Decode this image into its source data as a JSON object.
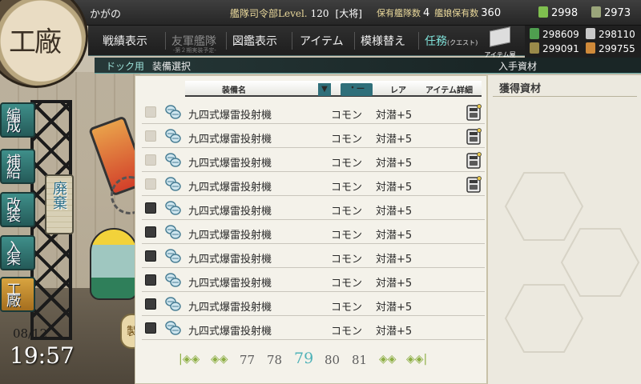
{
  "header": {
    "admiral_name": "かがの",
    "hq_label": "艦隊司令部Level.",
    "hq_level": "120",
    "rank": "[大将]",
    "ships_label": "保有艦隊数",
    "ships_count": "4",
    "girls_label": "艦娘保有数",
    "girls_count": "360",
    "bucket": "2998",
    "dev_material": "2973"
  },
  "resources": {
    "fuel": "298609",
    "steel": "298110",
    "ammo": "299091",
    "bauxite": "299755"
  },
  "menu": {
    "items": [
      {
        "label": "戦績表示"
      },
      {
        "label": "友軍艦隊",
        "sub": "-第２期実装予定-"
      },
      {
        "label": "図鑑表示"
      },
      {
        "label": "アイテム"
      },
      {
        "label": "模様替え"
      },
      {
        "label": "任務",
        "tag": "(クエスト)"
      }
    ],
    "item_shop": "アイテム屋"
  },
  "breadcrumb": {
    "parent": "ドック用",
    "current": "装備選択",
    "right": "入手資材"
  },
  "side_nav": [
    {
      "label": "編成"
    },
    {
      "label": "補給"
    },
    {
      "label": "改装"
    },
    {
      "label": "入渠"
    },
    {
      "label": "工廠"
    }
  ],
  "badge": "工廠",
  "dev_button": "廃棄",
  "make_button": "製",
  "clock": {
    "date": "08/12",
    "time": "19:57"
  },
  "table": {
    "col_name": "装備名",
    "sort_arrow": "▼",
    "sort_button": "・—",
    "col_rarity": "レア",
    "col_detail": "アイテム詳細",
    "rows": [
      {
        "name": "九四式爆雷投射機",
        "rarity": "コモン",
        "detail": "対潜+5"
      },
      {
        "name": "九四式爆雷投射機",
        "rarity": "コモン",
        "detail": "対潜+5"
      },
      {
        "name": "九四式爆雷投射機",
        "rarity": "コモン",
        "detail": "対潜+5"
      },
      {
        "name": "九四式爆雷投射機",
        "rarity": "コモン",
        "detail": "対潜+5"
      },
      {
        "name": "九四式爆雷投射機",
        "rarity": "コモン",
        "detail": "対潜+5"
      },
      {
        "name": "九四式爆雷投射機",
        "rarity": "コモン",
        "detail": "対潜+5"
      },
      {
        "name": "九四式爆雷投射機",
        "rarity": "コモン",
        "detail": "対潜+5"
      },
      {
        "name": "九四式爆雷投射機",
        "rarity": "コモン",
        "detail": "対潜+5"
      },
      {
        "name": "九四式爆雷投射機",
        "rarity": "コモン",
        "detail": "対潜+5"
      },
      {
        "name": "九四式爆雷投射機",
        "rarity": "コモン",
        "detail": "対潜+5"
      }
    ]
  },
  "pager": {
    "first": "|◈◈",
    "prev": "◈◈",
    "pages": [
      "77",
      "78",
      "79",
      "80",
      "81"
    ],
    "next": "◈◈",
    "last": "◈◈|"
  },
  "right_panel": {
    "title": "獲得資材"
  },
  "colors": {
    "accent": "#4fb2b8",
    "menu_bg": "#262626",
    "panel_bg": "#f4f2ea",
    "teal_button": "#2f6f7a"
  }
}
